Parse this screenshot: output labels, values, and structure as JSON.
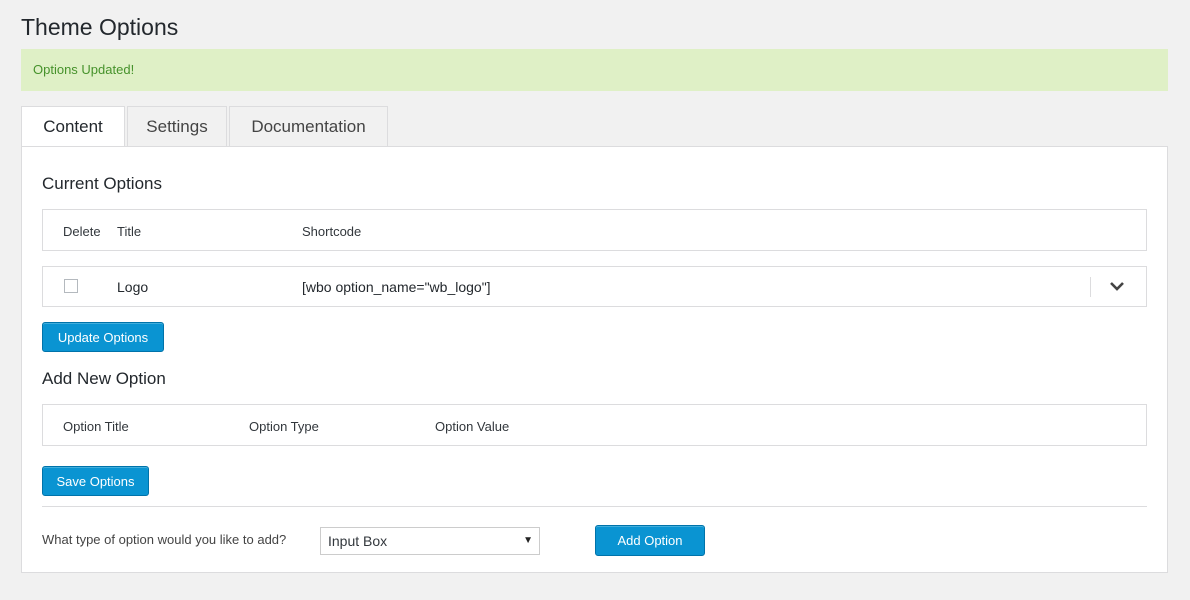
{
  "page": {
    "title": "Theme Options"
  },
  "notice": {
    "text": "Options Updated!"
  },
  "tabs": [
    {
      "label": "Content",
      "active": true
    },
    {
      "label": "Settings",
      "active": false
    },
    {
      "label": "Documentation",
      "active": false
    }
  ],
  "current_options": {
    "title": "Current Options",
    "headers": {
      "delete": "Delete",
      "title": "Title",
      "shortcode": "Shortcode"
    },
    "rows": [
      {
        "checked": false,
        "title": "Logo",
        "shortcode": "[wbo option_name=\"wb_logo\"]"
      }
    ],
    "update_button": "Update Options"
  },
  "add_new": {
    "title": "Add New Option",
    "headers": {
      "option_title": "Option Title",
      "option_type": "Option Type",
      "option_value": "Option Value"
    },
    "save_button": "Save Options"
  },
  "add_option": {
    "question": "What type of option would you like to add?",
    "selected_type": "Input Box",
    "button": "Add Option"
  },
  "colors": {
    "accent": "#0a94d2",
    "notice_bg": "#dff0c6",
    "notice_text": "#46922b"
  },
  "icons": {
    "expand": "chevron-down-icon",
    "dropdown": "triangle-down-icon"
  }
}
